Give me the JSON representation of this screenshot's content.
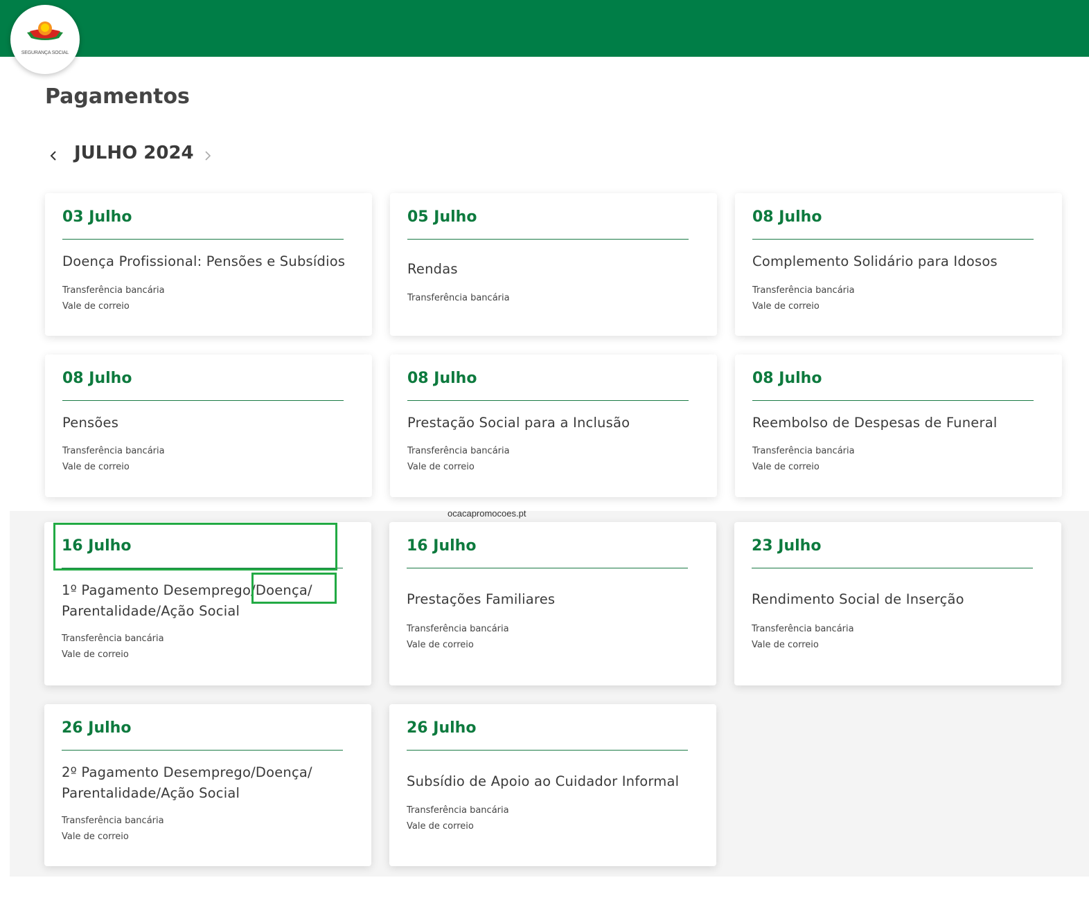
{
  "header": {
    "logo_text": "SEGURANÇA SOCIAL",
    "brand_color": "#007e47",
    "logo_colors": {
      "orange": "#f7941d",
      "yellow": "#ffd200",
      "red": "#d7261e",
      "green": "#1e8c3a"
    }
  },
  "page": {
    "title": "Pagamentos",
    "month": "JULHO 2024",
    "prev_icon": "chevron-left-icon",
    "next_icon": "chevron-right-icon"
  },
  "watermark": "ocacapromocoes.pt",
  "colors": {
    "date_green": "#0d7a3e",
    "highlight_green": "#22aa44"
  },
  "cards": [
    {
      "date": "03 Julho",
      "title": "Doença Profissional: Pensões e Subsídios",
      "methods": [
        "Transferência bancária",
        "Vale de correio"
      ]
    },
    {
      "date": "05 Julho",
      "title": "Rendas",
      "methods": [
        "Transferência bancária"
      ]
    },
    {
      "date": "08 Julho",
      "title": "Complemento Solidário para Idosos",
      "methods": [
        "Transferência bancária",
        "Vale de correio"
      ]
    },
    {
      "date": "08 Julho",
      "title": "Pensões",
      "methods": [
        "Transferência bancária",
        "Vale de correio"
      ]
    },
    {
      "date": "08 Julho",
      "title": "Prestação Social para a Inclusão",
      "methods": [
        "Transferência bancária",
        "Vale de correio"
      ]
    },
    {
      "date": "08 Julho",
      "title": "Reembolso de Despesas de Funeral",
      "methods": [
        "Transferência bancária",
        "Vale de correio"
      ]
    },
    {
      "date": "16 Julho",
      "title": "1º Pagamento Desemprego/Doença/ Parentalidade/Ação Social",
      "methods": [
        "Transferência bancária",
        "Vale de correio"
      ]
    },
    {
      "date": "16 Julho",
      "title": "Prestações Familiares",
      "methods": [
        "Transferência bancária",
        "Vale de correio"
      ]
    },
    {
      "date": "23 Julho",
      "title": "Rendimento Social de Inserção",
      "methods": [
        "Transferência bancária",
        "Vale de correio"
      ]
    },
    {
      "date": "26 Julho",
      "title": "2º Pagamento Desemprego/Doença/ Parentalidade/Ação Social",
      "methods": [
        "Transferência bancária",
        "Vale de correio"
      ]
    },
    {
      "date": "26 Julho",
      "title": "Subsídio de Apoio ao Cuidador Informal",
      "methods": [
        "Transferência bancária",
        "Vale de correio"
      ]
    }
  ]
}
